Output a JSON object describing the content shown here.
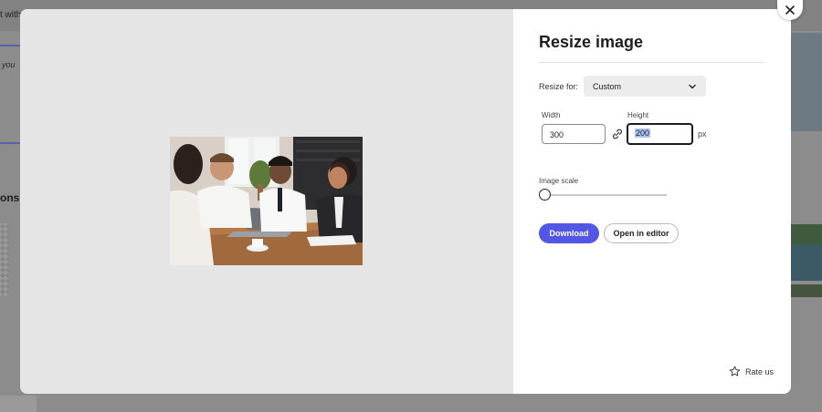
{
  "background": {
    "text_top": "t with",
    "text_mid": "you",
    "text_section": "ons"
  },
  "modal": {
    "title": "Resize image",
    "resize_for_label": "Resize for:",
    "resize_for_value": "Custom",
    "width_label": "Width",
    "width_value": "300",
    "height_label": "Height",
    "height_value": "200",
    "unit": "px",
    "scale_label": "Image scale",
    "scale_value": 0,
    "download_label": "Download",
    "open_editor_label": "Open in editor",
    "rate_label": "Rate us",
    "accent_color": "#5258e4"
  },
  "icons": {
    "close": "close-icon",
    "chevron": "chevron-down-icon",
    "link": "link-icon",
    "star": "star-icon"
  }
}
